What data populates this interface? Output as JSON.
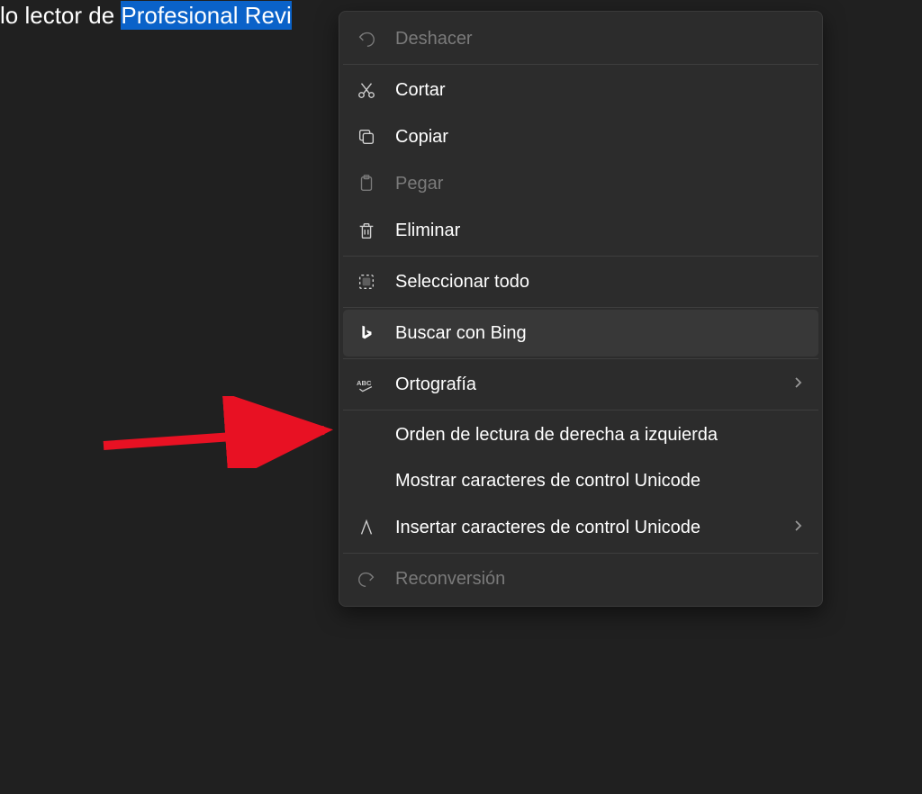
{
  "textLine": {
    "prefix": "lo lector de ",
    "selected": "Profesional Revi"
  },
  "menu": {
    "undo": "Deshacer",
    "cut": "Cortar",
    "copy": "Copiar",
    "paste": "Pegar",
    "delete": "Eliminar",
    "selectAll": "Seleccionar todo",
    "searchBing": "Buscar con Bing",
    "spelling": "Ortografía",
    "rtlOrder": "Orden de lectura de derecha a izquierda",
    "showUnicode": "Mostrar caracteres de control Unicode",
    "insertUnicode": "Insertar caracteres de control Unicode",
    "reconversion": "Reconversión"
  }
}
